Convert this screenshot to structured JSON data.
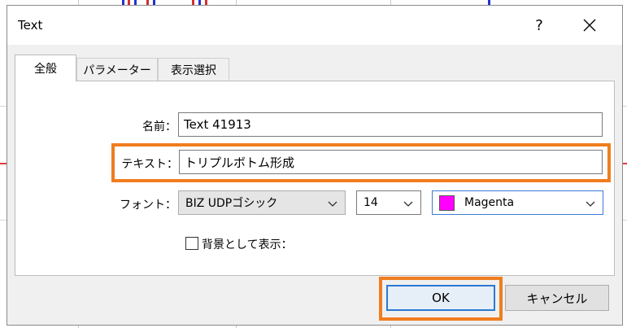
{
  "dialog": {
    "title": "Text",
    "help_glyph": "?",
    "tabs": [
      {
        "label": "全般",
        "active": true
      },
      {
        "label": "パラメーター",
        "active": false
      },
      {
        "label": "表示選択",
        "active": false
      }
    ]
  },
  "form": {
    "name_label": "名前：",
    "name_value": "Text 41913",
    "text_label": "テキスト：",
    "text_value": "トリプルボトム形成",
    "font_label": "フォント：",
    "font_family": "BIZ UDPゴシック",
    "font_size": "14",
    "color_name": "Magenta",
    "color_hex": "#ff00ff",
    "background_label": "背景として表示：",
    "background_checked": false
  },
  "buttons": {
    "ok": "OK",
    "cancel": "キャンセル"
  },
  "colors": {
    "highlight": "#f07d1f",
    "focus_border": "#2a7ad4"
  },
  "icons": {
    "close": "close-icon",
    "dropdown": "chevron-down-icon"
  }
}
